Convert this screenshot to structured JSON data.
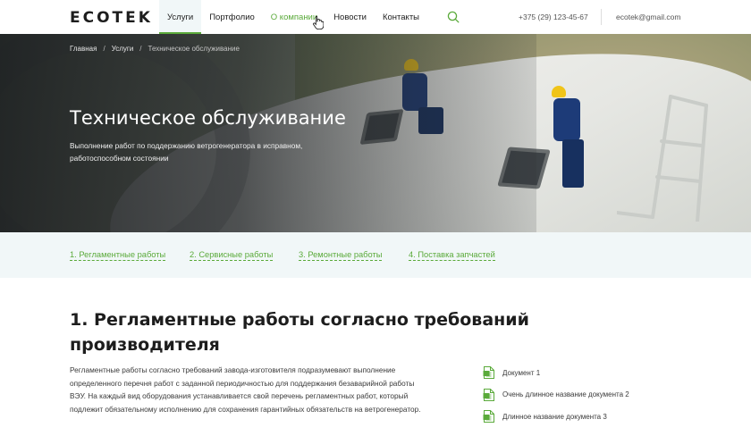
{
  "header": {
    "logo": "ECOTEK",
    "nav": [
      {
        "label": "Услуги",
        "state": "active"
      },
      {
        "label": "Портфолио",
        "state": "normal"
      },
      {
        "label": "О компании",
        "state": "hover"
      },
      {
        "label": "Новости",
        "state": "normal"
      },
      {
        "label": "Контакты",
        "state": "normal"
      }
    ],
    "search_icon": "search-icon",
    "phone": "+375 (29) 123-45-67",
    "email": "ecotek@gmail.com"
  },
  "hero": {
    "breadcrumb": [
      "Главная",
      "Услуги",
      "Техническое обслуживание"
    ],
    "title": "Техническое обслуживание",
    "subtitle": "Выполнение работ по поддержанию ветрогенератора в исправном, работоспособном состоянии"
  },
  "anchors": [
    "1. Регламентные работы",
    "2. Сервисные работы",
    "3. Ремонтные работы",
    "4. Поставка запчастей"
  ],
  "section": {
    "title": "1. Регламентные работы согласно требований производителя",
    "text": "Регламентные работы согласно требований завода-изготовителя подразумевают выполнение определенного перечня работ с заданной периодичностью для поддержания безаварийной работы ВЭУ. На каждый вид оборудования устанавливается свой перечень регламентных работ, который подлежит обязательному исполнению для сохранения гарантийных обязательств на ветрогенератор."
  },
  "documents": [
    {
      "label": "Документ 1",
      "icon": "document-icon"
    },
    {
      "label": "Очень длинное название документа 2",
      "icon": "document-icon"
    },
    {
      "label": "Длинное название документа 3",
      "icon": "document-icon"
    }
  ],
  "colors": {
    "accent": "#5aaa3a",
    "anchor_bg": "#f1f7f8",
    "text": "#1d1d1d"
  }
}
